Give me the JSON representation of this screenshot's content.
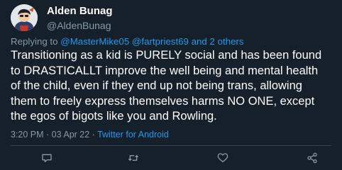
{
  "author": {
    "display_name": "Alden Bunag",
    "handle": "@AldenBunag",
    "avatar_icon": "avatar-icon"
  },
  "reply_context": {
    "prefix": "Replying to ",
    "user1": "@MasterMike05",
    "user2": "@fartpriest69",
    "conjunction": " and ",
    "others": "2 others"
  },
  "tweet": {
    "lines": [
      "Transitioning as a kid is PURELY social and has been found",
      "to DRASTICALLT improve the well being and mental health",
      "of the child, even if they end up not being trans, allowing",
      "them to freely express themselves harms NO ONE, except",
      "the egos of bigots like you and Rowling."
    ]
  },
  "meta": {
    "time": "3:20 PM",
    "sep1": " · ",
    "date": "03 Apr 22",
    "sep2": " · ",
    "app": "Twitter for Android"
  },
  "actions": [
    {
      "name": "reply",
      "icon": "reply-icon"
    },
    {
      "name": "retweet",
      "icon": "retweet-icon"
    },
    {
      "name": "like",
      "icon": "heart-icon"
    },
    {
      "name": "share",
      "icon": "share-icon"
    }
  ],
  "colors": {
    "background": "#15202b",
    "text": "#ffffff",
    "secondary": "#8899a6",
    "link": "#1d9bf0",
    "divider": "#38444d"
  }
}
